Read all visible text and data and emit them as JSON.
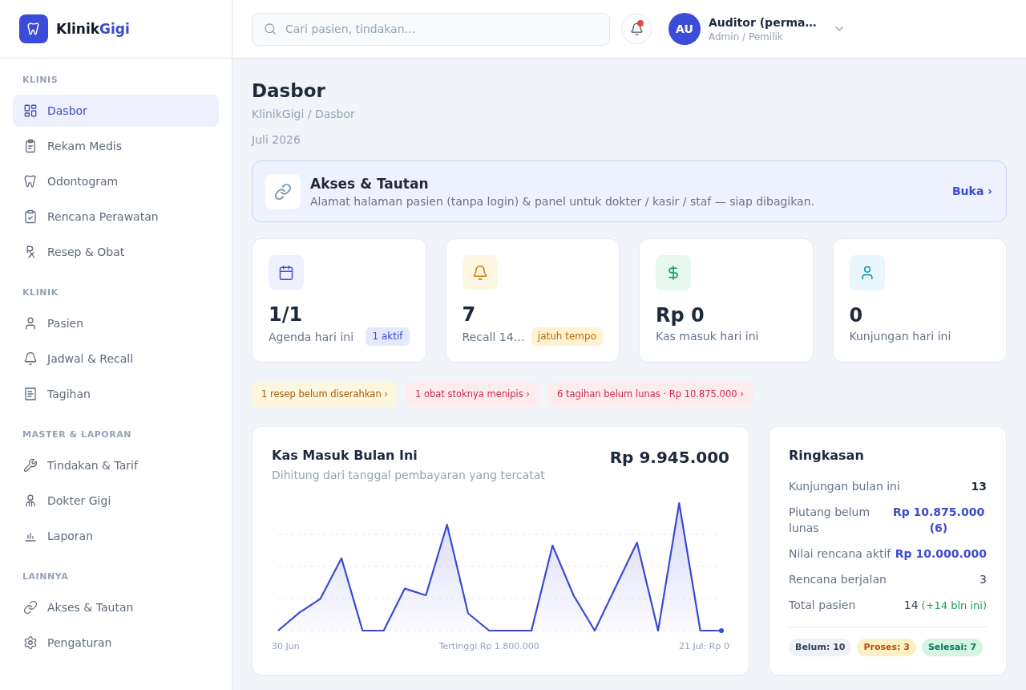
{
  "sidebar": {
    "brand": {
      "name": "Klinik",
      "accent": "Gigi"
    },
    "sections": [
      {
        "label": "KLINIS",
        "items": [
          {
            "label": "Dasbor",
            "selected": true
          },
          {
            "label": "Rekam Medis",
            "selected": false
          },
          {
            "label": "Odontogram",
            "selected": false
          },
          {
            "label": "Rencana Perawatan",
            "selected": false
          },
          {
            "label": "Resep & Obat",
            "selected": false
          }
        ]
      },
      {
        "label": "KLINIK",
        "items": [
          {
            "label": "Pasien",
            "selected": false
          },
          {
            "label": "Jadwal & Recall",
            "selected": false
          },
          {
            "label": "Tagihan",
            "selected": false
          }
        ]
      },
      {
        "label": "MASTER & LAPORAN",
        "items": [
          {
            "label": "Tindakan & Tarif",
            "selected": false
          },
          {
            "label": "Dokter Gigi",
            "selected": false
          },
          {
            "label": "Laporan",
            "selected": false
          }
        ]
      },
      {
        "label": "LAINNYA",
        "items": [
          {
            "label": "Akses & Tautan",
            "selected": false
          },
          {
            "label": "Pengaturan",
            "selected": false
          }
        ]
      }
    ]
  },
  "header": {
    "search": {
      "placeholder": "Cari pasien, tindakan..."
    },
    "notifications": {
      "unread": true
    },
    "user": {
      "initials": "AU",
      "name": "Auditor (perma…",
      "role": "Admin / Pemilik"
    }
  },
  "page": {
    "title": "Dasbor",
    "breadcrumb": "KlinikGigi / Dasbor",
    "period": "Juli 2026"
  },
  "banner": {
    "title": "Akses & Tautan",
    "description": "Alamat halaman pasien (tanpa login) & panel untuk dokter / kasir / staf — siap dibagikan.",
    "action": "Buka ›"
  },
  "stats": [
    {
      "value": "1/1",
      "label": "Agenda hari ini",
      "badge": {
        "text": "1 aktif",
        "kind": "info"
      }
    },
    {
      "value": "7",
      "label": "Recall 14…",
      "badge": {
        "text": "jatuh tempo",
        "kind": "warning"
      }
    },
    {
      "value": "Rp 0",
      "label": "Kas masuk hari ini"
    },
    {
      "value": "0",
      "label": "Kunjungan hari ini"
    }
  ],
  "alerts": [
    {
      "text": "1 resep belum diserahkan ›",
      "kind": "warning"
    },
    {
      "text": "1 obat stoknya menipis ›",
      "kind": "danger"
    },
    {
      "text": "6 tagihan belum lunas · Rp 10.875.000 ›",
      "kind": "danger"
    }
  ],
  "cash_chart": {
    "title": "Kas Masuk Bulan Ini",
    "subtitle": "Dihitung dari tanggal pembayaran yang tercatat",
    "total": "Rp 9.945.000",
    "start_label": "30 Jun",
    "peak_label": "Tertinggi Rp 1.800.000",
    "end_label": "21 Jul: Rp 0"
  },
  "summary": {
    "title": "Ringkasan",
    "rows": [
      {
        "label": "Kunjungan bulan ini",
        "value": "13",
        "kind": "strong"
      },
      {
        "label": "Piutang belum lunas",
        "value": "Rp 10.875.000 (6)",
        "kind": "accent"
      },
      {
        "label": "Nilai rencana aktif",
        "value": "Rp 10.000.000",
        "kind": "accent"
      },
      {
        "label": "Rencana berjalan",
        "value": "3",
        "kind": "plain"
      },
      {
        "label": "Total pasien",
        "value": "14",
        "note": "(+14 bln ini)",
        "kind": "plain"
      }
    ],
    "badges": [
      {
        "text": "Belum: 10",
        "kind": "neutral"
      },
      {
        "text": "Proses: 3",
        "kind": "warning"
      },
      {
        "text": "Selesai: 7",
        "kind": "success"
      }
    ]
  }
}
